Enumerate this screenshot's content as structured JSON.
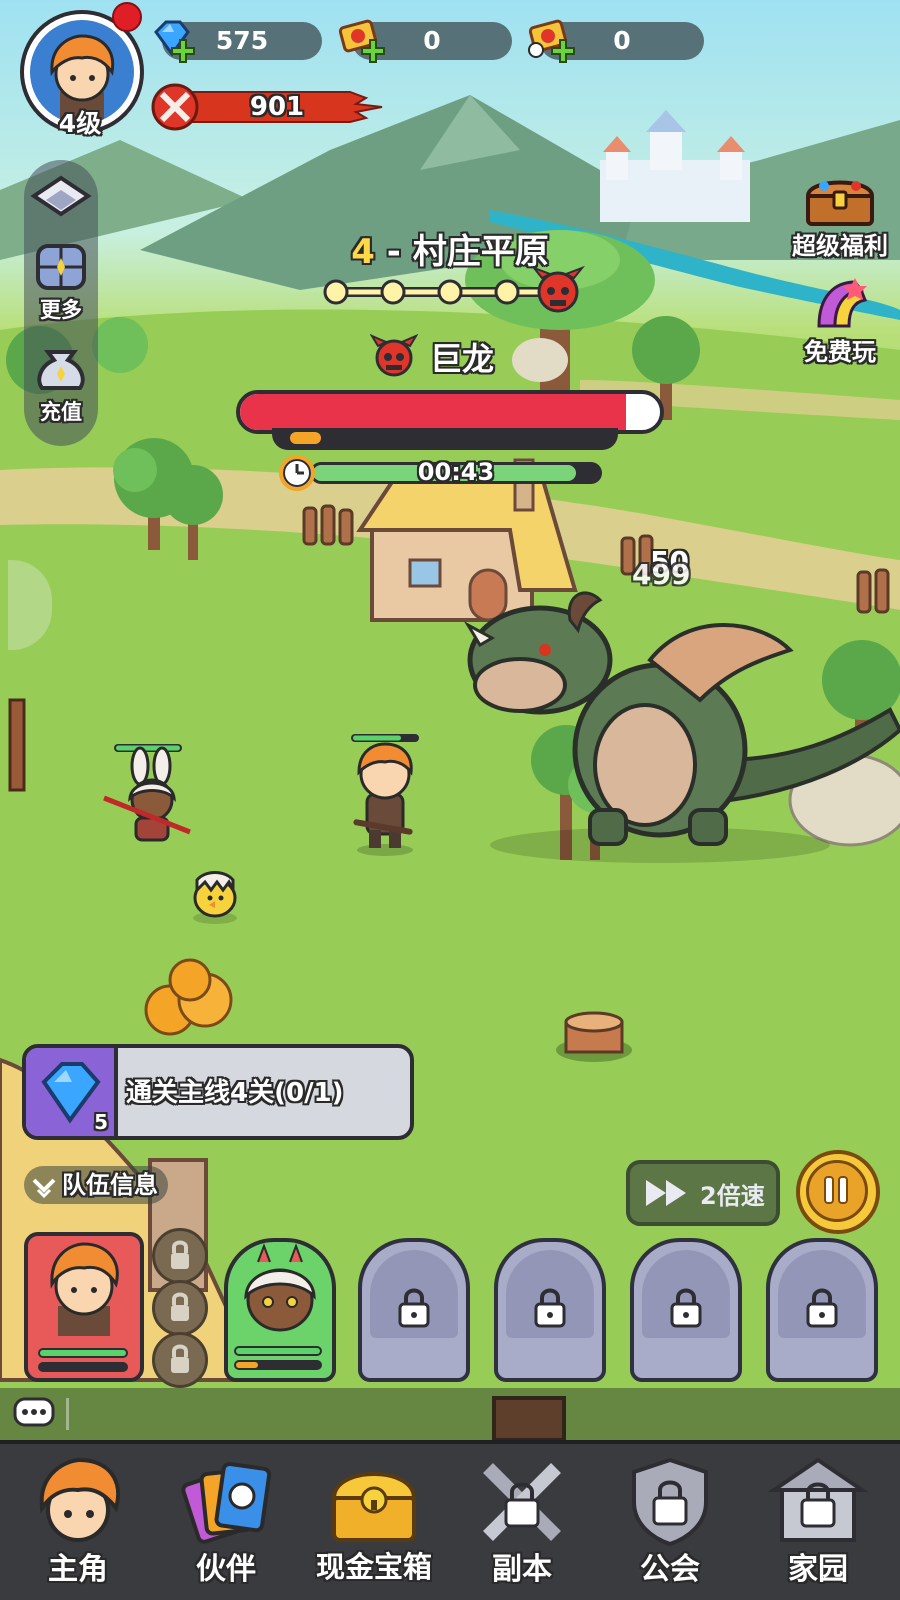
{
  "player": {
    "level_label": "4级"
  },
  "resources": {
    "gems": "575",
    "tickets": "0",
    "timed_tickets": "0",
    "power": "901"
  },
  "side_menu": {
    "more_label": "更多",
    "recharge_label": "充值"
  },
  "right_menu": {
    "super_bonus_label": "超级福利",
    "free_play_label": "免费玩"
  },
  "stage": {
    "number": "4",
    "separator": " - ",
    "name": "村庄平原"
  },
  "boss": {
    "name": "巨龙",
    "health_fraction": 0.92,
    "rage_fraction": 0.1,
    "timer": "00:43",
    "timer_fraction": 0.92
  },
  "damage_numbers": [
    "50",
    "499"
  ],
  "quest": {
    "text": "通关主线4关(0/1)",
    "reward_count": "5"
  },
  "team_info_label": "队伍信息",
  "speed_label": "2倍速",
  "bottom_nav": {
    "hero": "主角",
    "partner": "伙伴",
    "cash_chest": "现金宝箱",
    "dungeon": "副本",
    "guild": "公会",
    "home": "家园"
  },
  "colors": {
    "boss_hp": "#e8334a",
    "timer_fill": "#7cd47a",
    "gem": "#3aa6ff",
    "power_bar": "#d8351f",
    "quest_icon_bg": "#8a63d6",
    "pause_ring": "#f5c93a"
  }
}
